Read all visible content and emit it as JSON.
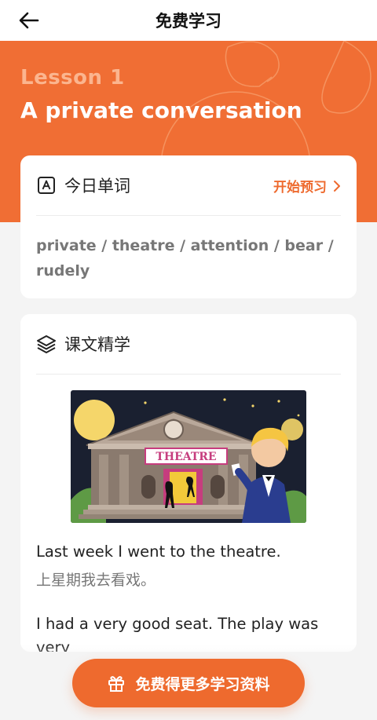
{
  "header": {
    "title": "免费学习",
    "back_icon": "arrow-left-icon"
  },
  "lesson": {
    "number": "Lesson 1",
    "title": "A private conversation"
  },
  "vocab_card": {
    "label": "今日单词",
    "icon": "letter-a-icon",
    "action": "开始预习",
    "words": "private / theatre / attention / bear / rudely"
  },
  "text_card": {
    "label": "课文精学",
    "icon": "layers-icon",
    "illustration_sign": "THEATRE",
    "sentences": [
      {
        "en": "Last week I went to the theatre.",
        "zh": "上星期我去看戏。"
      },
      {
        "en": "I had a very good seat. The play was very",
        "zh": ""
      }
    ]
  },
  "cta": {
    "label": "免费得更多学习资料",
    "icon": "gift-icon"
  },
  "colors": {
    "accent": "#ee6a2e",
    "hero": "#f06e34",
    "background": "#f4f4f4"
  }
}
